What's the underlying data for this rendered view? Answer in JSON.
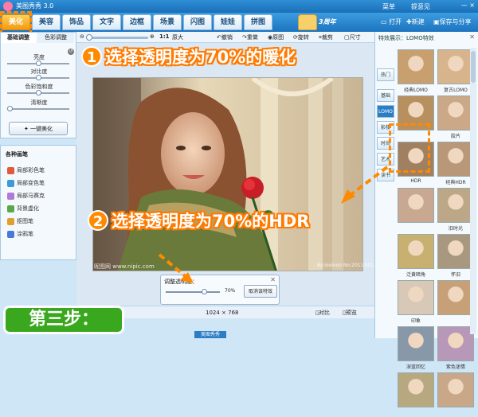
{
  "app": {
    "title": "美图秀秀 3.0",
    "anniversary": "3周年",
    "menu": "菜单",
    "feedback": "提意见",
    "minimize": "—",
    "close": "×"
  },
  "nav_tabs": [
    "美化",
    "美容",
    "饰品",
    "文字",
    "边框",
    "场景",
    "闪图",
    "娃娃",
    "拼图"
  ],
  "file_toolbar": {
    "open": "打开",
    "new": "新建",
    "save_share": "保存与分享"
  },
  "edit_toolbar": {
    "zoom_ratio": "1:1",
    "original_size": "原大",
    "undo": "撤销",
    "redo": "重做",
    "original": "原图",
    "rotate": "旋转",
    "crop": "裁剪",
    "size": "尺寸"
  },
  "left_panel": {
    "tab_basic": "基础调整",
    "tab_color": "色彩调整",
    "sliders": [
      {
        "label": "亮度",
        "value": 0.5
      },
      {
        "label": "对比度",
        "value": 0.5
      },
      {
        "label": "色彩饱和度",
        "value": 0.5
      },
      {
        "label": "清晰度",
        "value": 0.0
      }
    ],
    "one_click": "一键美化"
  },
  "brush_panel": {
    "title": "各种画笔",
    "items": [
      {
        "label": "局部彩色笔",
        "color": "#e05a3c"
      },
      {
        "label": "局部变色笔",
        "color": "#3c9ad6"
      },
      {
        "label": "局部马赛克",
        "color": "#b07ad6"
      },
      {
        "label": "背景虚化",
        "color": "#5aa84a"
      },
      {
        "label": "抠图笔",
        "color": "#e0a030"
      },
      {
        "label": "涂鸦笔",
        "color": "#4a7ad6"
      }
    ]
  },
  "canvas": {
    "watermark": "昵图网 www.nipic.com",
    "watermark_id": "By:iooiooo No:20110422225145012391",
    "dimensions": "1024 × 768"
  },
  "transparency": {
    "label": "调整透明度：",
    "percent": "70%",
    "value": 0.7,
    "cancel": "取消该特效"
  },
  "status_bar": {
    "compare": "对比",
    "preview": "预览"
  },
  "right_panel": {
    "title": "特效展示：LOMO特效",
    "categories": [
      "热门",
      "基础",
      "LOMO",
      "影楼",
      "时尚",
      "艺术",
      "读书"
    ],
    "active_category": "LOMO",
    "effects": [
      {
        "name": "经典LOMO",
        "tone": "#c8a070"
      },
      {
        "name": "复古LOMO",
        "tone": "#d8b48c"
      },
      {
        "name": "",
        "tone": "#b89060"
      },
      {
        "name": "胶片",
        "tone": "#caa888"
      },
      {
        "name": "HDR",
        "tone": "#a08060"
      },
      {
        "name": "经典HDR",
        "tone": "#b89878"
      },
      {
        "name": "",
        "tone": "#c8a890"
      },
      {
        "name": "旧时光",
        "tone": "#bca888"
      },
      {
        "name": "泛黄暗角",
        "tone": "#c8b070"
      },
      {
        "name": "怀旧",
        "tone": "#a89880"
      },
      {
        "name": "印象",
        "tone": "#d8c8b8"
      },
      {
        "name": "",
        "tone": "#c8a078"
      },
      {
        "name": "深蓝回忆",
        "tone": "#8898a8"
      },
      {
        "name": "紫色迷情",
        "tone": "#b898b8"
      },
      {
        "name": "",
        "tone": "#b8a880"
      },
      {
        "name": "",
        "tone": "#c8a888"
      }
    ]
  },
  "annotations": {
    "step1_num": "1",
    "step1_text": "选择透明度为70%的暖化",
    "step2_num": "2",
    "step2_text": "选择透明度为70%的HDR",
    "step_label": "第三步："
  },
  "bottom_tab": "美图秀秀",
  "colors": {
    "accent_orange": "#ff8a00",
    "brand_blue": "#1d74bf",
    "step_green": "#3aa81e"
  }
}
